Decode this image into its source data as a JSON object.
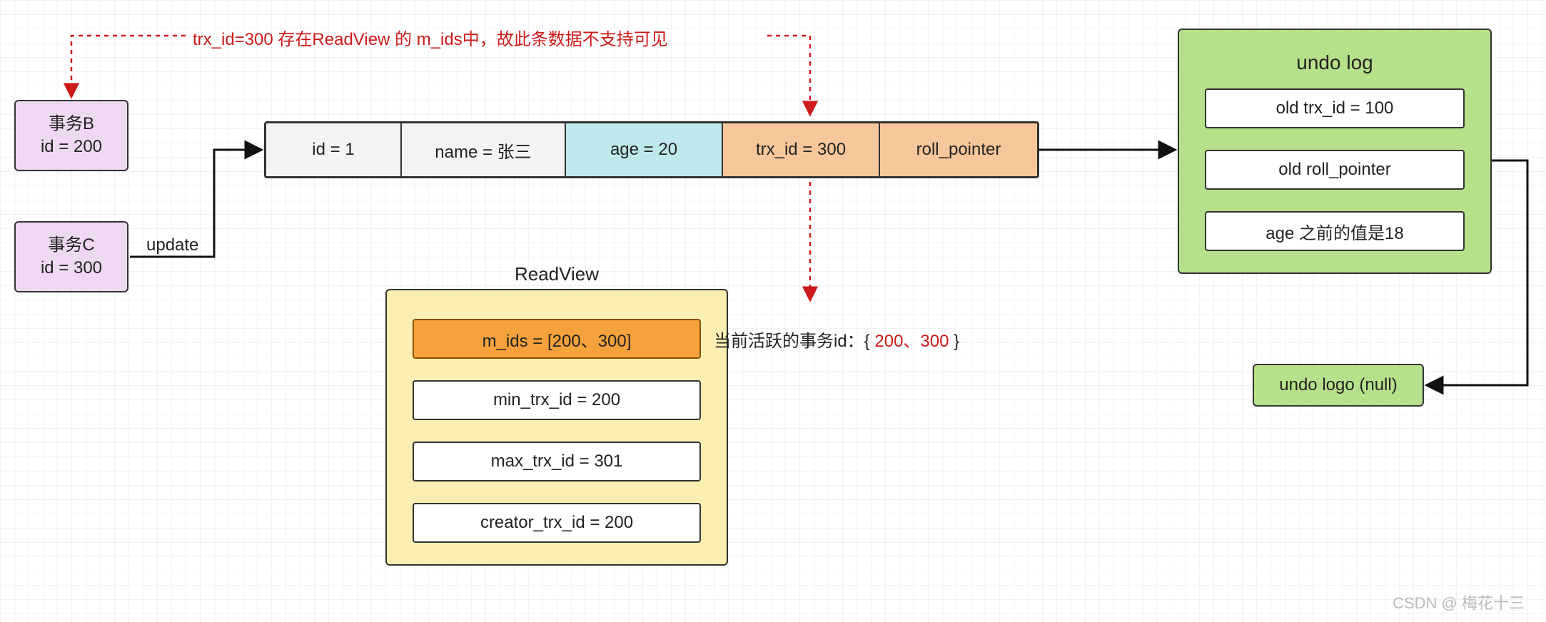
{
  "annotation_top": "trx_id=300 存在ReadView 的 m_ids中，故此条数据不支持可见",
  "transactions": {
    "b_name": "事务B",
    "b_id": "id = 200",
    "c_name": "事务C",
    "c_id": "id = 300"
  },
  "update_label": "update",
  "row": {
    "id": "id = 1",
    "name": "name = 张三",
    "age": "age = 20",
    "trx_id": "trx_id = 300",
    "roll_pointer": "roll_pointer"
  },
  "readview": {
    "title": "ReadView",
    "m_ids": "m_ids = [200、300]",
    "min_trx_id": "min_trx_id = 200",
    "max_trx_id": "max_trx_id = 301",
    "creator_trx_id": "creator_trx_id = 200"
  },
  "active_txn_prefix": "当前活跃的事务id：{ ",
  "active_txn_ids": "200、300",
  "active_txn_suffix": " }",
  "undo_log": {
    "title": "undo log",
    "old_trx_id": "old trx_id = 100",
    "old_roll_pointer": "old roll_pointer",
    "age_prev": "age 之前的值是18"
  },
  "undo_null": "undo logo (null)",
  "watermark": "CSDN @ 梅花十三"
}
